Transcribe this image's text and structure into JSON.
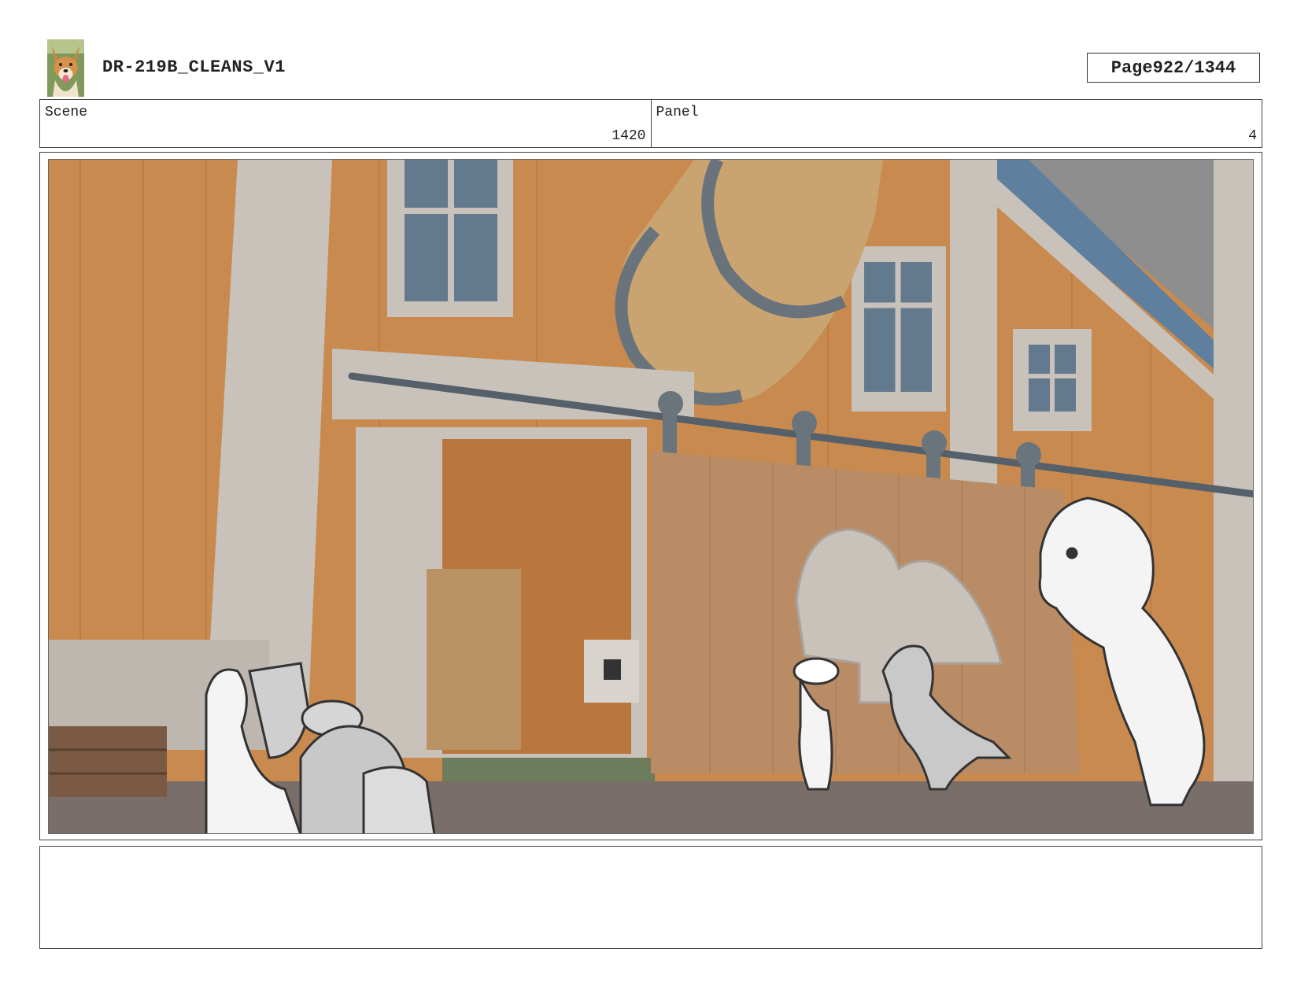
{
  "header": {
    "title": "DR-219B_CLEANS_V1",
    "page_label": "Page",
    "page_value": "922/1344",
    "logo_icon": "dog-photo-icon"
  },
  "info": {
    "scene_label": "Scene",
    "scene_value": "1420",
    "panel_label": "Panel",
    "panel_value": "4"
  },
  "panel": {
    "description_icons": [
      "barn-facade",
      "wooden-barrel",
      "sliding-barn-door",
      "dinosaur-sketch",
      "rancher-sketch"
    ]
  },
  "notes": {
    "text": ""
  }
}
